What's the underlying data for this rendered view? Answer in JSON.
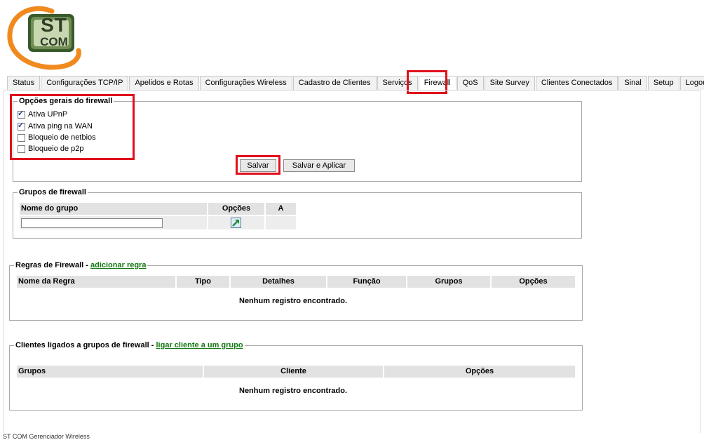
{
  "logo": {
    "line1": "ST",
    "line2": "COM"
  },
  "tabs": [
    {
      "label": "Status"
    },
    {
      "label": "Configurações TCP/IP"
    },
    {
      "label": "Apelidos e Rotas"
    },
    {
      "label": "Configurações Wireless"
    },
    {
      "label": "Cadastro de Clientes"
    },
    {
      "label": "Serviços"
    },
    {
      "label": "Firewall",
      "active": true
    },
    {
      "label": "QoS"
    },
    {
      "label": "Site Survey"
    },
    {
      "label": "Clientes Conectados"
    },
    {
      "label": "Sinal"
    },
    {
      "label": "Setup"
    },
    {
      "label": "Logout"
    }
  ],
  "general": {
    "legend": "Opções gerais do firewall",
    "options": [
      {
        "label": "Ativa UPnP",
        "checked": true
      },
      {
        "label": "Ativa ping na WAN",
        "checked": true
      },
      {
        "label": "Bloqueio de netbios",
        "checked": false
      },
      {
        "label": "Bloqueio de p2p",
        "checked": false
      }
    ],
    "save_label": "Salvar",
    "save_apply_label": "Salvar e Aplicar"
  },
  "groups": {
    "legend": "Grupos de firewall",
    "columns": [
      "Nome do grupo",
      "Opções",
      "A"
    ],
    "name_value": "",
    "add_icon": "add-arrow-icon"
  },
  "rules": {
    "legend_prefix": "Regras de Firewall - ",
    "legend_link": "adicionar regra",
    "columns": [
      "Nome da Regra",
      "Tipo",
      "Detalhes",
      "Função",
      "Grupos",
      "Opções"
    ],
    "empty": "Nenhum registro encontrado."
  },
  "clients": {
    "legend_prefix": "Clientes ligados a grupos de firewall - ",
    "legend_link": "ligar cliente a um grupo",
    "columns": [
      "Grupos",
      "Cliente",
      "Opções"
    ],
    "empty": "Nenhum registro encontrado."
  },
  "footer": "ST COM Gerenciador Wireless",
  "colors": {
    "highlight": "#e0101c",
    "logo_orange": "#f08a1e",
    "logo_green": "#3a5a2c",
    "link": "#117711"
  }
}
